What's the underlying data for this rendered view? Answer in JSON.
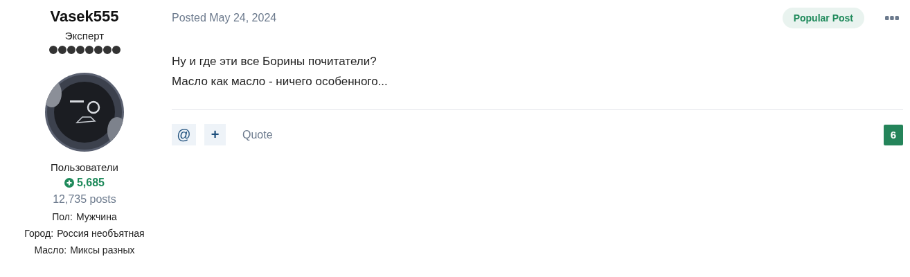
{
  "author": {
    "name": "Vasek555",
    "rank": "Эксперт",
    "pips": [
      {
        "filled": true
      },
      {
        "filled": true
      },
      {
        "filled": true
      },
      {
        "filled": true
      },
      {
        "filled": true
      },
      {
        "filled": true
      },
      {
        "filled": true
      },
      {
        "filled": true
      }
    ],
    "group": "Пользователи",
    "reputation": "5,685",
    "posts": "12,735 posts",
    "fields": [
      {
        "label": "Пол:",
        "value": "Мужчина"
      },
      {
        "label": "Город:",
        "value": "Россия необъятная"
      },
      {
        "label": "Масло:",
        "value": "Миксы разных"
      }
    ]
  },
  "post": {
    "date": "Posted May 24, 2024",
    "badge": "Popular Post",
    "lines": [
      "Ну и где эти все Борины почитатели?",
      "Масло как масло - ничего особенного..."
    ],
    "actions": [
      {
        "kind": "mention",
        "label": "@"
      },
      {
        "kind": "plus",
        "label": "+"
      },
      {
        "kind": "link",
        "label": "Quote"
      }
    ],
    "reaction_count": "6"
  }
}
